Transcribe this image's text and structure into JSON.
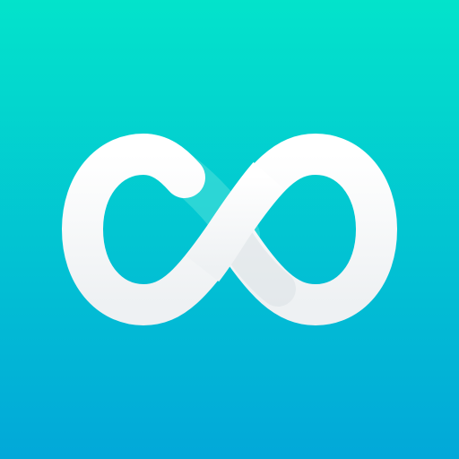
{
  "icon": {
    "name": "infinity-icon",
    "colors": {
      "background_top": "#03E3CB",
      "background_bottom": "#02A8D9",
      "symbol": "#F7F8F9",
      "symbol_shadow": "#DCE3E6",
      "inner_overlap": "#4FE0DA"
    }
  }
}
